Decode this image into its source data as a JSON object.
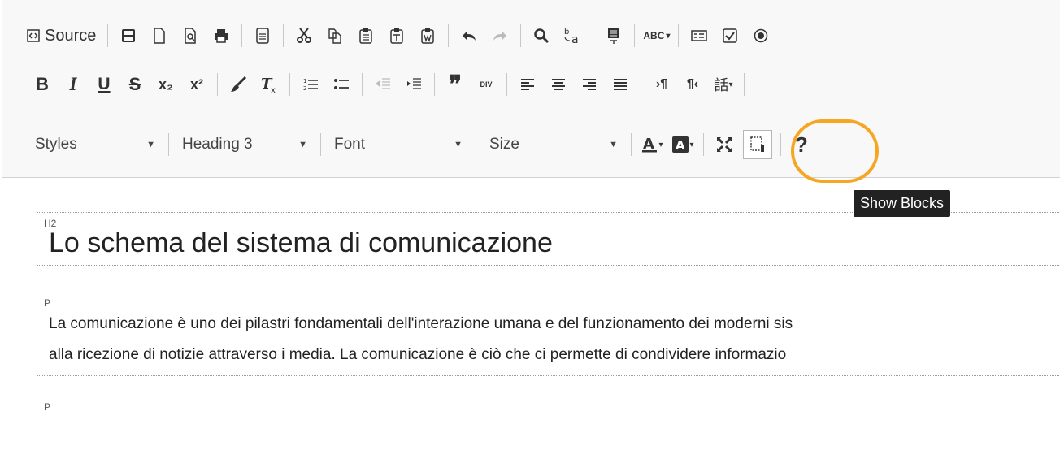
{
  "toolbar": {
    "source_label": "Source",
    "styles_label": "Styles",
    "format_label": "Heading 3",
    "font_label": "Font",
    "size_label": "Size",
    "bold": "B",
    "italic": "I",
    "underline": "U",
    "strike": "S",
    "subscript": "x₂",
    "superscript": "x²",
    "help": "?",
    "abc": "ABC",
    "blockquote": "❞",
    "div": "DIV"
  },
  "tooltip": "Show Blocks",
  "content": {
    "h2_tag": "H2",
    "h2_text": "Lo schema del sistema di comunicazione",
    "p1_tag": "P",
    "p1_line1": "La comunicazione è uno dei pilastri fondamentali dell'interazione umana e del funzionamento dei moderni sis",
    "p1_line2": "alla ricezione di notizie attraverso i media. La comunicazione è ciò che ci permette di condividere informazio",
    "p2_tag": "P"
  },
  "colors": {
    "highlight": "#f5a623",
    "tooltip_bg": "#222222",
    "toolbar_bg": "#f8f8f8"
  }
}
